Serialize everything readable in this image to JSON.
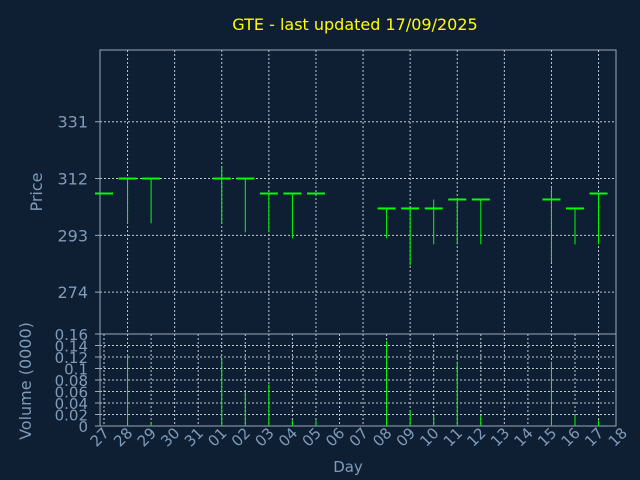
{
  "title": "GTE - last updated 17/09/2025",
  "colors": {
    "background": "#0f1f33",
    "frame": "#9aa8b8",
    "grid": "#c0c8d0",
    "title": "#ffff00",
    "label": "#7f9bb8",
    "price": "#00ff00",
    "volume": "#00ff00"
  },
  "chart_data": [
    {
      "type": "ohlc",
      "ylabel": "Price",
      "ylim": [
        260,
        355
      ],
      "yticks": [
        274,
        293,
        312,
        331
      ],
      "grid": true,
      "points": [
        {
          "day": 0,
          "open": 307,
          "high": 307,
          "low": 307,
          "close": 307
        },
        {
          "day": 1,
          "open": 312,
          "high": 312,
          "low": 297,
          "close": 312
        },
        {
          "day": 2,
          "open": 312,
          "high": 312,
          "low": 297,
          "close": 312
        },
        {
          "day": 5,
          "open": 312,
          "high": 316,
          "low": 297,
          "close": 312
        },
        {
          "day": 6,
          "open": 312,
          "high": 312,
          "low": 294,
          "close": 312
        },
        {
          "day": 7,
          "open": 307,
          "high": 307,
          "low": 294,
          "close": 307
        },
        {
          "day": 8,
          "open": 307,
          "high": 307,
          "low": 292,
          "close": 307
        },
        {
          "day": 9,
          "open": 307,
          "high": 307,
          "low": 307,
          "close": 307
        },
        {
          "day": 12,
          "open": 302,
          "high": 302,
          "low": 292,
          "close": 302
        },
        {
          "day": 13,
          "open": 302,
          "high": 302,
          "low": 283,
          "close": 302
        },
        {
          "day": 14,
          "open": 302,
          "high": 305,
          "low": 290,
          "close": 302
        },
        {
          "day": 15,
          "open": 305,
          "high": 305,
          "low": 290,
          "close": 305
        },
        {
          "day": 16,
          "open": 305,
          "high": 305,
          "low": 290,
          "close": 305
        },
        {
          "day": 19,
          "open": 305,
          "high": 309,
          "low": 284,
          "close": 305
        },
        {
          "day": 20,
          "open": 302,
          "high": 302,
          "low": 290,
          "close": 302
        },
        {
          "day": 21,
          "open": 307,
          "high": 307,
          "low": 290,
          "close": 307
        }
      ]
    },
    {
      "type": "bar",
      "ylabel": "Volume (0000)",
      "xlabel": "Day",
      "ylim": [
        0,
        0.16
      ],
      "yticks": [
        0,
        0.02,
        0.04,
        0.06,
        0.08,
        0.1,
        0.12,
        0.14,
        0.16
      ],
      "ytick_labels": [
        "0",
        "0.02",
        "0.04",
        "0.06",
        "0.08",
        "0.1",
        "0.12",
        "0.14",
        "0.16"
      ],
      "grid": true,
      "categories": [
        "27",
        "28",
        "29",
        "30",
        "31",
        "01",
        "02",
        "03",
        "04",
        "05",
        "06",
        "07",
        "08",
        "09",
        "10",
        "11",
        "12",
        "13",
        "14",
        "15",
        "16",
        "17",
        "18"
      ],
      "points": [
        {
          "day": 0,
          "value": 0
        },
        {
          "day": 1,
          "value": 0.125
        },
        {
          "day": 2,
          "value": 0.005
        },
        {
          "day": 5,
          "value": 0.115
        },
        {
          "day": 6,
          "value": 0.06
        },
        {
          "day": 7,
          "value": 0.072
        },
        {
          "day": 8,
          "value": 0.01
        },
        {
          "day": 9,
          "value": 0.01
        },
        {
          "day": 12,
          "value": 0.148
        },
        {
          "day": 13,
          "value": 0.027
        },
        {
          "day": 14,
          "value": 0.018
        },
        {
          "day": 15,
          "value": 0.112
        },
        {
          "day": 16,
          "value": 0.018
        },
        {
          "day": 19,
          "value": 0.112
        },
        {
          "day": 20,
          "value": 0.018
        },
        {
          "day": 21,
          "value": 0.01
        }
      ]
    }
  ]
}
